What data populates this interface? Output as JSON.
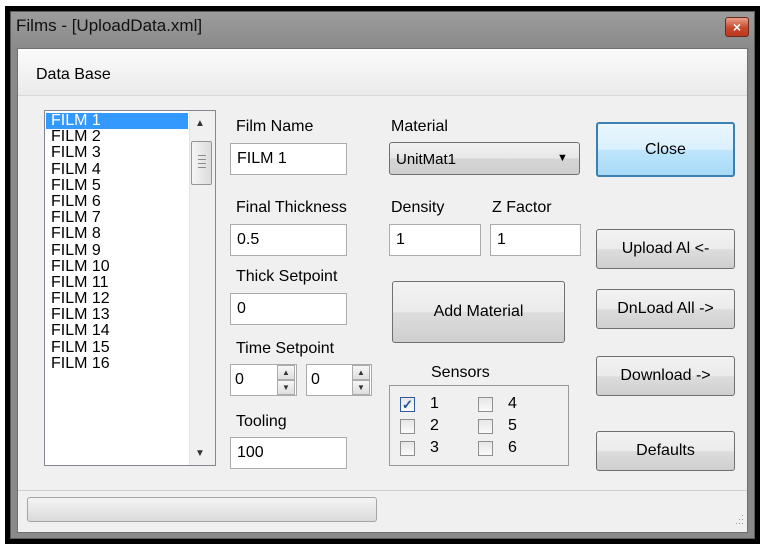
{
  "window": {
    "title": "Films - [UploadData.xml]",
    "close_glyph": "×"
  },
  "menu": {
    "items": [
      "Data Base"
    ]
  },
  "films": [
    "FILM 1",
    "FILM 2",
    "FILM 3",
    "FILM 4",
    "FILM 5",
    "FILM 6",
    "FILM 7",
    "FILM 8",
    "FILM 9",
    "FILM 10",
    "FILM 11",
    "FILM 12",
    "FILM 13",
    "FILM 14",
    "FILM 15",
    "FILM 16"
  ],
  "selected_film_index": 0,
  "form": {
    "film_name_label": "Film Name",
    "film_name_value": "FILM 1",
    "final_thickness_label": "Final Thickness",
    "final_thickness_value": "0.5",
    "thick_setpoint_label": "Thick Setpoint",
    "thick_setpoint_value": "0",
    "time_setpoint_label": "Time Setpoint",
    "time_setpoint_min": "0",
    "time_setpoint_sec": "0",
    "tooling_label": "Tooling",
    "tooling_value": "100",
    "material_label": "Material",
    "material_value": "UnitMat1",
    "density_label": "Density",
    "density_value": "1",
    "zfactor_label": "Z Factor",
    "zfactor_value": "1",
    "add_material_label": "Add Material"
  },
  "sensors": {
    "label": "Sensors",
    "items": [
      {
        "label": "1",
        "checked": true
      },
      {
        "label": "2",
        "checked": false
      },
      {
        "label": "3",
        "checked": false
      },
      {
        "label": "4",
        "checked": false
      },
      {
        "label": "5",
        "checked": false
      },
      {
        "label": "6",
        "checked": false
      }
    ]
  },
  "buttons": {
    "close": "Close",
    "upload_all": "Upload Al <-",
    "download_all": "DnLoad All ->",
    "download": "Download ->",
    "defaults": "Defaults"
  },
  "icons": {
    "checkmark": "✓",
    "dropdown": "▼",
    "up": "▲",
    "down": "▼"
  }
}
